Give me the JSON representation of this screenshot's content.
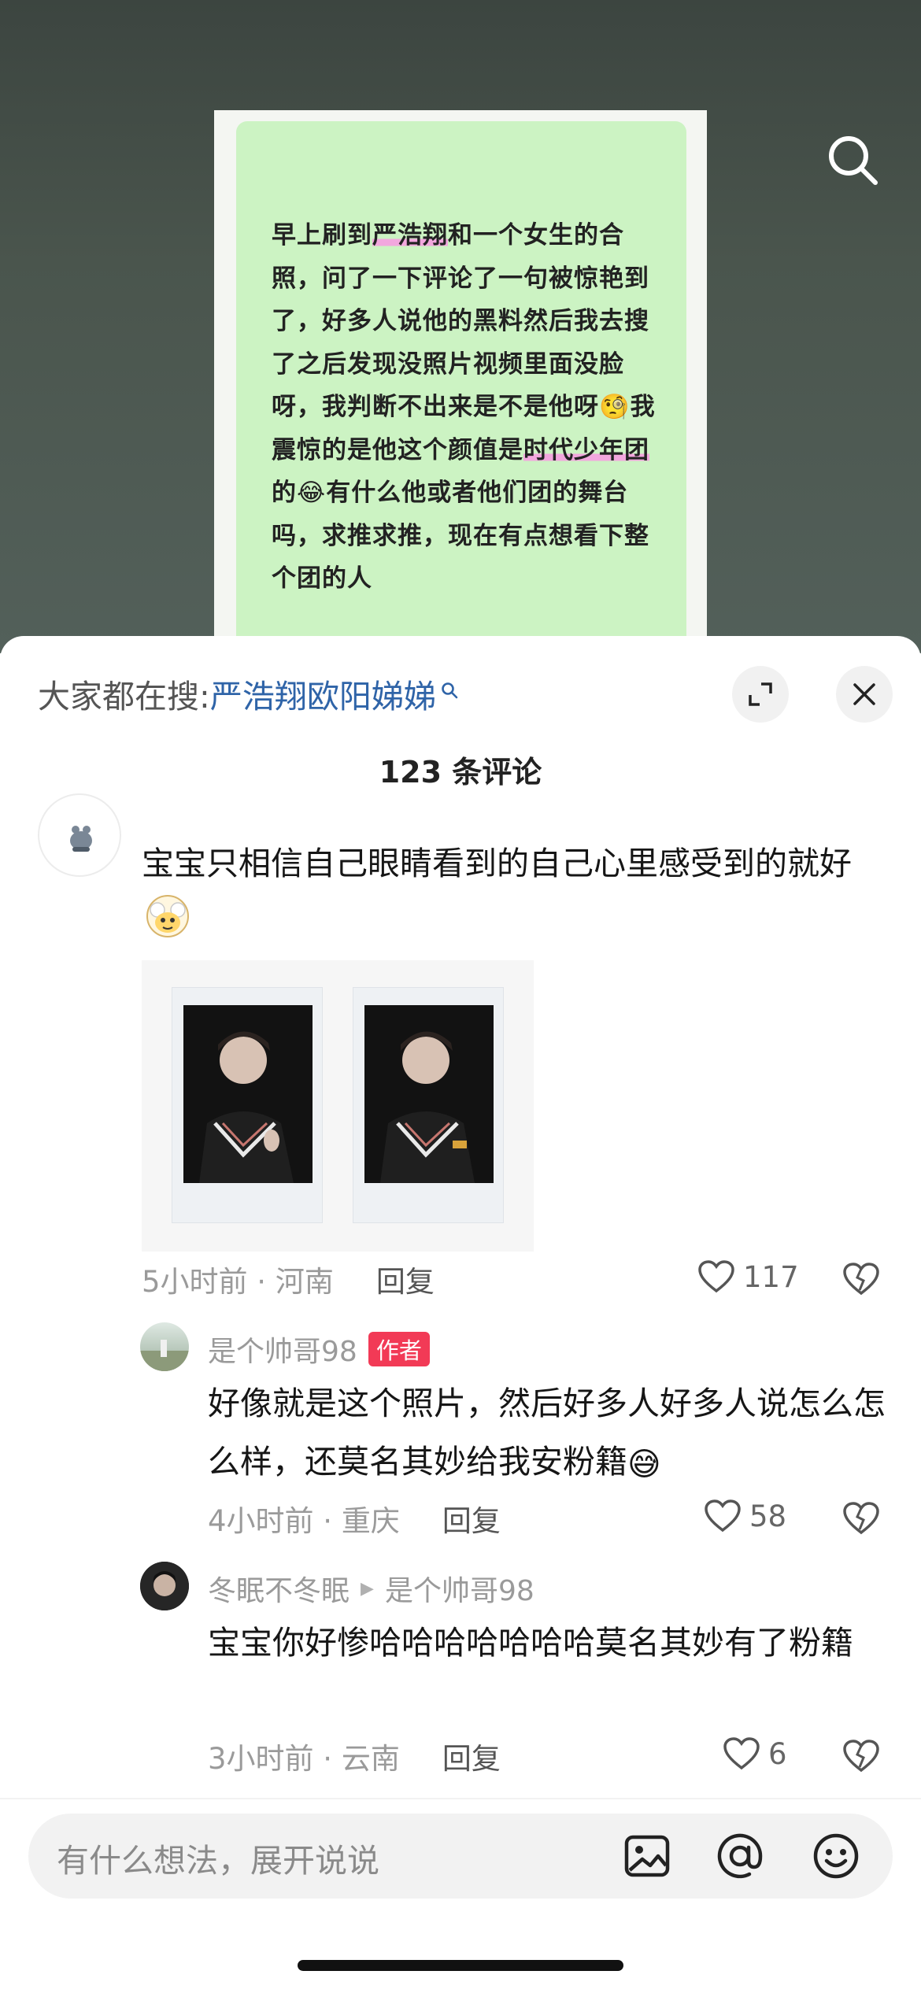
{
  "note": {
    "segments": [
      {
        "text": "早上刷到",
        "hl": false
      },
      {
        "text": "严浩翔",
        "hl": true
      },
      {
        "text": "和一个女生的合照，问了一下评论了一句被惊艳到了，好多人说他的黑料然后我去搜了之后发现没照片视频里面没脸呀，我判断不出来是不是他呀",
        "hl": false
      },
      {
        "text": "🧐",
        "hl": false
      },
      {
        "text": "我震惊的是他这个颜值是",
        "hl": false
      },
      {
        "text": "时代少年团",
        "hl": true
      },
      {
        "text": "的",
        "hl": false
      },
      {
        "text": "😂",
        "hl": false
      },
      {
        "text": "有什么他或者他们团的舞台吗，求推求推，现在有点想看下整个团的人",
        "hl": false
      }
    ]
  },
  "hot_search": {
    "label": "大家都在搜:",
    "keyword": "严浩翔欧阳娣娣"
  },
  "comment_count": "123 条评论",
  "comments": [
    {
      "text": "宝宝只相信自己眼睛看到的自己心里感受到的就好",
      "time_location": "5小时前 · 河南",
      "reply_label": "回复",
      "likes": "117"
    }
  ],
  "replies": [
    {
      "name": "是个帅哥98",
      "tag": "作者",
      "text": "好像就是这个照片，然后好多人好多人说怎么怎么样，还莫名其妙给我安粉籍",
      "emoji": "😅",
      "time_location": "4小时前 · 重庆",
      "reply_label": "回复",
      "likes": "58"
    },
    {
      "name": "冬眠不冬眠",
      "reply_to": "是个帅哥98",
      "text": "宝宝你好惨哈哈哈哈哈哈哈莫名其妙有了粉籍",
      "time_location": "3小时前 · 云南",
      "reply_label": "回复",
      "likes": "6"
    }
  ],
  "input": {
    "placeholder": "有什么想法，展开说说"
  },
  "colors": {
    "note_bg": "#ccf3c3",
    "highlight": "#f2a7de",
    "keyword": "#2f64a8",
    "author_tag": "#f23a56"
  },
  "icons": [
    "search-icon",
    "magnifier-icon",
    "expand-icon",
    "close-icon",
    "heart-icon",
    "dislike-heart-icon",
    "image-icon",
    "at-icon",
    "emoji-icon"
  ]
}
